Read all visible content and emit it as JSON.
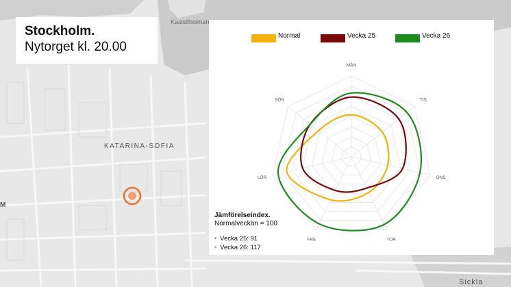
{
  "map": {
    "labels": {
      "kastellholmen": "Kastellholmen",
      "district": "KATARINA-SOFIA",
      "sickla": "Sickla",
      "m_edge": "M"
    },
    "marker_color": "#e8702a",
    "water_color": "#c9c9c9",
    "land_color": "#eaeaea"
  },
  "title_card": {
    "title": "Stockholm.",
    "subtitle": "Nytorget kl. 20.00"
  },
  "chart_data": {
    "type": "radar",
    "axes": [
      "MÅN",
      "TIS",
      "ONS",
      "TOR",
      "FRE",
      "LÖR",
      "SÖN"
    ],
    "rlim": [
      0,
      10
    ],
    "series": [
      {
        "name": "Normal",
        "color": "#f2b20a",
        "values": [
          5.2,
          4.9,
          4.6,
          4.9,
          5.9,
          8.2,
          5.2
        ]
      },
      {
        "name": "Vecka 25",
        "color": "#7a0a0a",
        "values": [
          7.4,
          7.5,
          6.5,
          4.3,
          4.6,
          6.2,
          6.5
        ]
      },
      {
        "name": "Vecka 26",
        "color": "#1e8c1e",
        "values": [
          7.9,
          8.8,
          8.7,
          9.3,
          9.2,
          9.3,
          6.5
        ]
      }
    ],
    "legend_position": "top",
    "grid": true
  },
  "index_note": {
    "heading": "Jämförelseindex.",
    "subheading": "Normalveckan = 100",
    "items": [
      "Vecka 25: 91",
      "Vecka 26: 117"
    ],
    "bullet": "•"
  }
}
